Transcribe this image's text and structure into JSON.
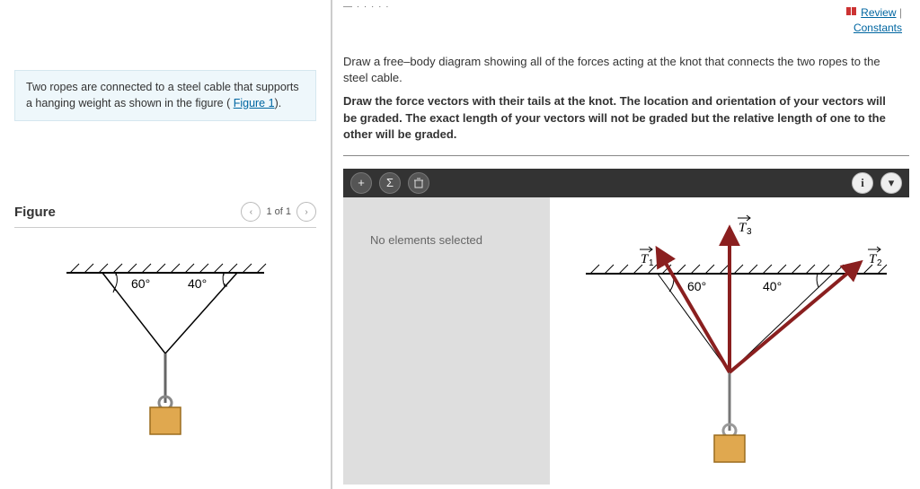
{
  "sidebar": {
    "problem_text_prefix": "Two ropes are connected to a steel cable that supports a hanging weight as shown in the figure ( ",
    "figure_link": "Figure 1",
    "problem_text_suffix": ").",
    "figure_title": "Figure",
    "pager": {
      "label": "1 of 1"
    },
    "figure": {
      "angle_left": "60°",
      "angle_right": "40°"
    }
  },
  "top_links": {
    "review": "Review",
    "constants": "Constants"
  },
  "instructions": {
    "line1": "Draw a free–body diagram showing all of the forces acting at the knot that connects the two ropes to the steel cable.",
    "line2": "Draw the force vectors with their tails at the knot. The location and orientation of your vectors will be graded. The exact length of your vectors will not be graded but the relative length of one to the other will be graded."
  },
  "toolbar": {
    "add": "+",
    "sigma": "Σ",
    "info": "i"
  },
  "workspace": {
    "status": "No elements selected",
    "diagram": {
      "angle_left": "60°",
      "angle_right": "40°",
      "T1": "T₁",
      "T2": "T₂",
      "T3": "T₃"
    }
  },
  "chart_data": {
    "type": "diagram",
    "scenario": "Two ropes attached to ceiling at angles 60° and 40° from horizontal meet at a knot; a steel cable hangs from the knot supporting a weight.",
    "vectors_drawn_in_workspace": [
      {
        "name": "T1",
        "angle_from_horizontal_deg": 60,
        "direction": "up-left"
      },
      {
        "name": "T2",
        "angle_from_horizontal_deg": 40,
        "direction": "up-right"
      },
      {
        "name": "T3",
        "direction": "up",
        "note": "vertical, drawn from knot upward"
      }
    ]
  }
}
